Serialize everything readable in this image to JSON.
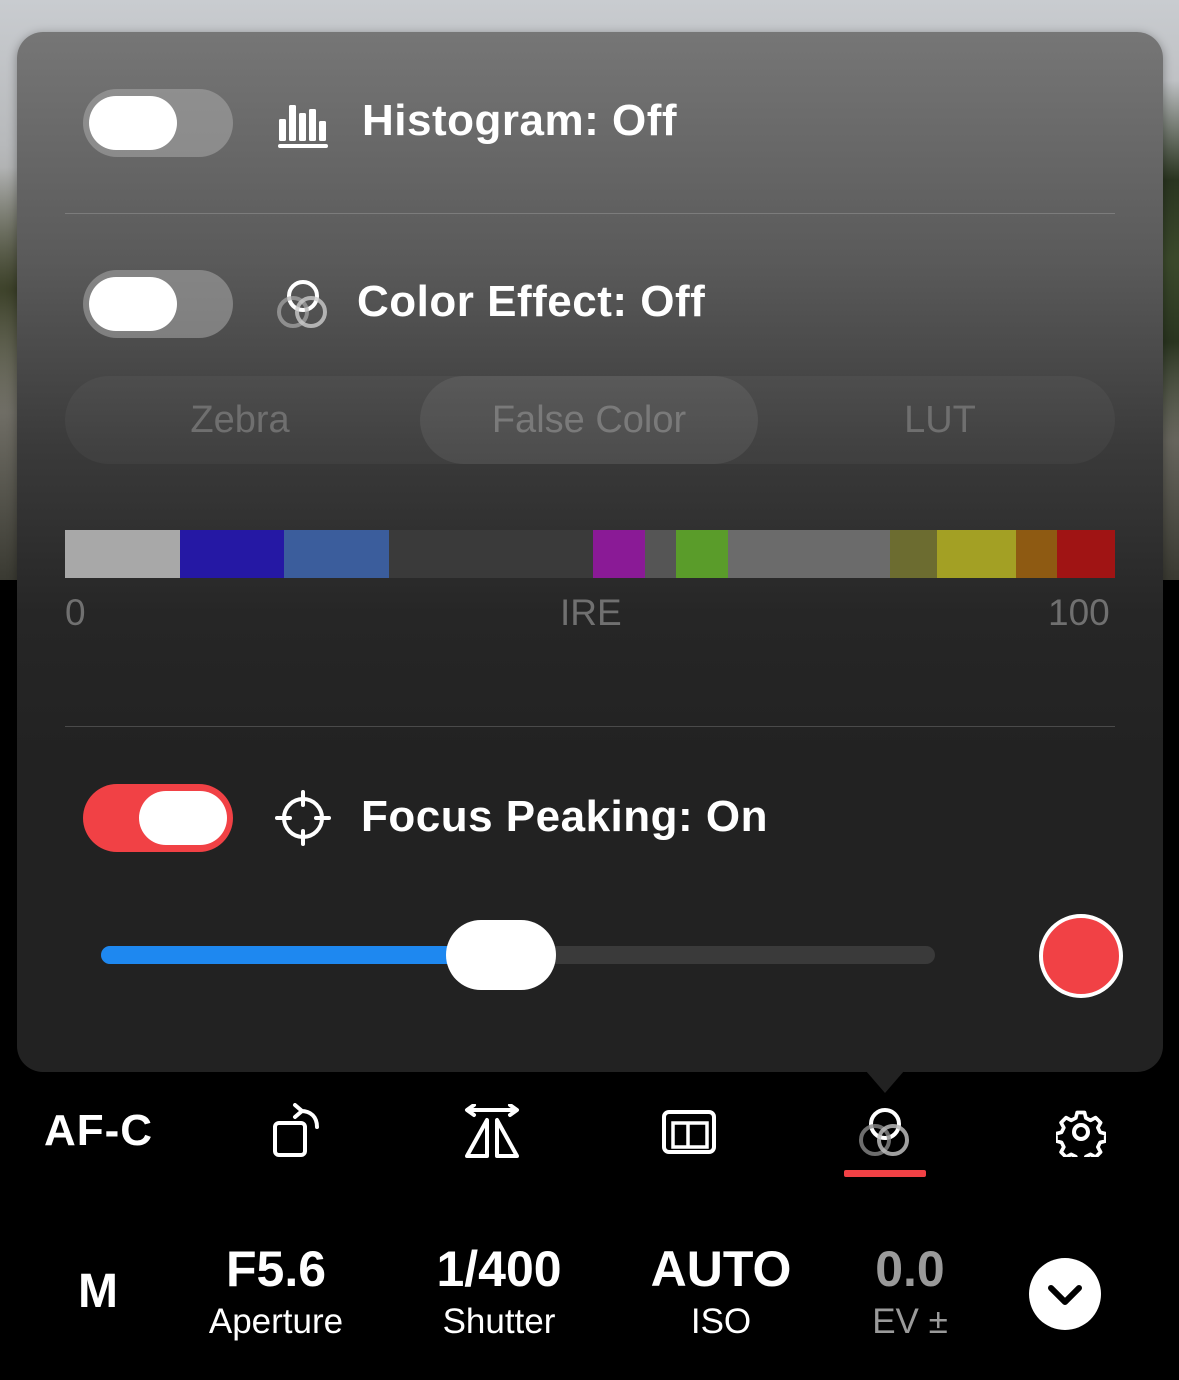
{
  "overlay": {
    "histogram": {
      "label": "Histogram: Off",
      "enabled": false,
      "icon": "histogram-icon"
    },
    "color_effect": {
      "label": "Color Effect: Off",
      "enabled": false,
      "icon": "color-circles-icon",
      "modes": [
        "Zebra",
        "False Color",
        "LUT"
      ],
      "selected_mode": "False Color"
    },
    "false_color_scale": {
      "min_label": "0",
      "unit_label": "IRE",
      "max_label": "100",
      "bands": [
        {
          "color": "#a8a8a8",
          "share": 11
        },
        {
          "color": "#2518a4",
          "share": 10
        },
        {
          "color": "#3b5d9c",
          "share": 10
        },
        {
          "color": "#3a3a3a",
          "share": 19.5
        },
        {
          "color": "#8a1a96",
          "share": 5
        },
        {
          "color": "#555555",
          "share": 3
        },
        {
          "color": "#5a9c2a",
          "share": 5
        },
        {
          "color": "#6b6b6b",
          "share": 15.5
        },
        {
          "color": "#6c6c30",
          "share": 4.5
        },
        {
          "color": "#a3a024",
          "share": 7.5
        },
        {
          "color": "#8e5a12",
          "share": 4
        },
        {
          "color": "#a01414",
          "share": 5.5
        }
      ]
    },
    "focus_peaking": {
      "label": "Focus Peaking: On",
      "enabled": true,
      "icon": "crosshair-icon",
      "intensity_fraction": 0.48,
      "color": "#f14145"
    }
  },
  "toolbar": {
    "af_mode": "AF-C",
    "icons": [
      "rotate-icon",
      "flip-icon",
      "frame-guide-icon",
      "color-circles-icon",
      "gear-icon"
    ],
    "active": "color-circles-icon",
    "accent": "#f14145"
  },
  "exposure": {
    "mode": "M",
    "aperture": {
      "value": "F5.6",
      "label": "Aperture"
    },
    "shutter": {
      "value": "1/400",
      "label": "Shutter"
    },
    "iso": {
      "value": "AUTO",
      "label": "ISO"
    },
    "ev": {
      "value": "0.0",
      "label": "EV ±"
    }
  }
}
